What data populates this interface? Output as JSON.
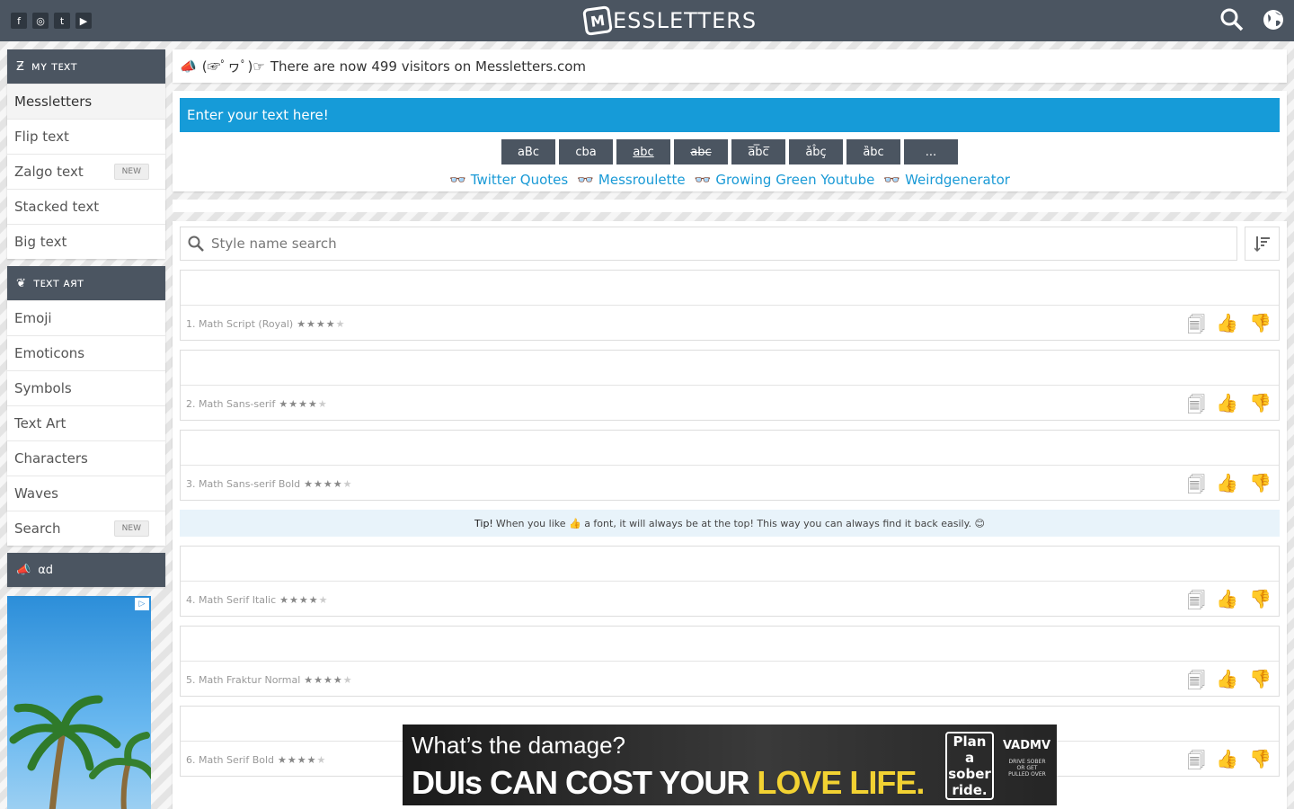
{
  "header": {
    "social": [
      "f",
      "◎",
      "t",
      "▶"
    ],
    "logo_mark": "M",
    "logo_word": "ESSLETTERS"
  },
  "sidebar": {
    "my_text": {
      "title": "ᴍʏ ᴛᴇxᴛ",
      "items": [
        {
          "label": "Messletters",
          "new": ""
        },
        {
          "label": "Flip text",
          "new": ""
        },
        {
          "label": "Zalgo text",
          "new": "NEW"
        },
        {
          "label": "Stacked text",
          "new": ""
        },
        {
          "label": "Big text",
          "new": ""
        }
      ]
    },
    "text_art": {
      "title": "ᴛᴇxᴛ ᴀяᴛ",
      "items": [
        {
          "label": "Emoji",
          "new": ""
        },
        {
          "label": "Emoticons",
          "new": ""
        },
        {
          "label": "Symbols",
          "new": ""
        },
        {
          "label": "Text Art",
          "new": ""
        },
        {
          "label": "Characters",
          "new": ""
        },
        {
          "label": "Waves",
          "new": ""
        },
        {
          "label": "Search",
          "new": "NEW"
        }
      ]
    },
    "ad_title": "αd"
  },
  "visitors": {
    "face": "(☞ﾟヮﾟ)☞",
    "text": "There are now 499 visitors on Messletters.com"
  },
  "input": {
    "placeholder": "Enter your text here!"
  },
  "style_buttons": [
    "aBc",
    "cba",
    "abc",
    "abc",
    "a̅b̅c̅",
    "ǎb̂ç",
    "ȁbc",
    "..."
  ],
  "links": [
    "Twitter Quotes",
    "Messroulette",
    "Growing Green Youtube",
    "Weirdgenerator"
  ],
  "search": {
    "placeholder": "Style name search"
  },
  "fonts": [
    {
      "name": "1. Math Script (Royal)"
    },
    {
      "name": "2. Math Sans-serif"
    },
    {
      "name": "3. Math Sans-serif Bold"
    },
    {
      "name": "4. Math Serif Italic"
    },
    {
      "name": "5. Math Fraktur Normal"
    },
    {
      "name": "6. Math Serif Bold"
    }
  ],
  "tip": {
    "label": "Tip!",
    "text": "When you like 👍 a font, it will always be at the top! This way you can always find it back easily. 😊"
  },
  "bottom_ad": {
    "line1": "What’s the damage?",
    "line2a": "DUIs CAN COST YOUR",
    "line2b": "LOVE LIFE.",
    "plan": "Plan a sober ride.",
    "brand": "VADMV",
    "badge": "DRIVE SOBER OR GET PULLED OVER"
  },
  "colors": {
    "header_bg": "#4b5561",
    "accent": "#169bd8",
    "link": "#1a9ad6"
  }
}
